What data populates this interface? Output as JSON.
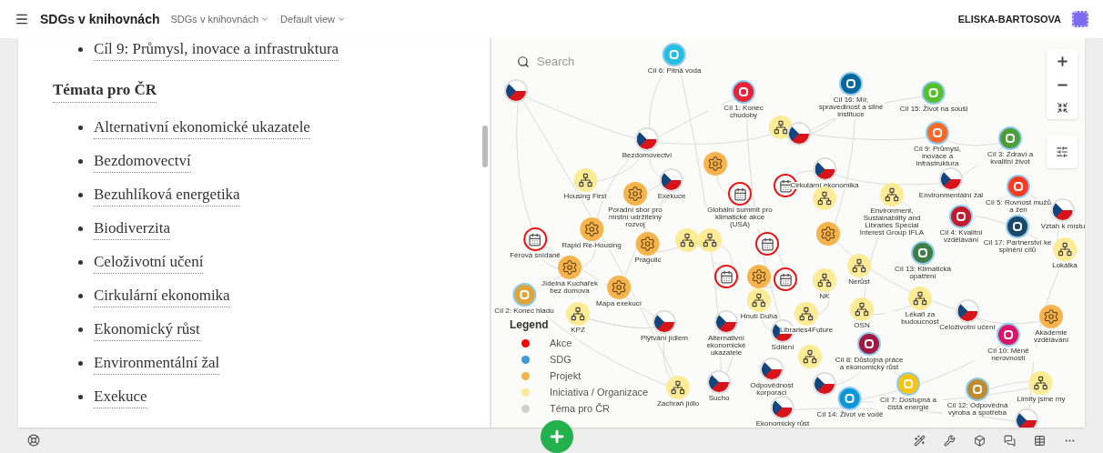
{
  "header": {
    "title": "SDGs v knihovnách",
    "menus": [
      "SDGs v knihovnách",
      "Default view"
    ],
    "user": "ELISKA-BARTOSOVA"
  },
  "document": {
    "links": [
      "Cíl 9: Průmysl, inovace a infrastruktura"
    ],
    "heading": "Témata pro ČR",
    "topics": [
      "Alternativní ekonomické ukazatele",
      "Bezdomovectví",
      "Bezuhlíková energetika",
      "Biodiverzita",
      "Celoživotní učení",
      "Cirkulární ekonomika",
      "Ekonomický růst",
      "Environmentální žal",
      "Exekuce"
    ]
  },
  "map": {
    "search": {
      "placeholder": "Search"
    },
    "legend": {
      "title": "Legend",
      "items": [
        {
          "label": "Akce",
          "color": "#ff0000"
        },
        {
          "label": "SDG",
          "color": "#3b9bd6"
        },
        {
          "label": "Projekt",
          "color": "#f7b44c"
        },
        {
          "label": "Iniciativa / Organizace",
          "color": "#fdeb96"
        },
        {
          "label": "Téma pro ČR",
          "color": "#cfcfcf"
        }
      ]
    },
    "nodes": [
      {
        "kind": "sdg",
        "label": "Cíl 6: Pitná voda",
        "color": "#26bde2"
      },
      {
        "kind": "topic"
      },
      {
        "kind": "sdg",
        "label": "Cíl 1: Konec chudoby",
        "color": "#e5243b"
      },
      {
        "kind": "topic",
        "label": "Bezdomovectví"
      },
      {
        "kind": "initiative"
      },
      {
        "kind": "topic"
      },
      {
        "kind": "project"
      },
      {
        "kind": "initiative",
        "label": "Housing First"
      },
      {
        "kind": "topic",
        "label": "Exekuce"
      },
      {
        "kind": "project",
        "label": "Poradní sbor pro místní udržitelný rozvoj"
      },
      {
        "kind": "event",
        "label": "Globální summit pro klimatické akce (USA)"
      },
      {
        "kind": "event"
      },
      {
        "kind": "project",
        "label": "Rapid Re-Housing"
      },
      {
        "kind": "project",
        "label": "Pragulic"
      },
      {
        "kind": "initiative"
      },
      {
        "kind": "initiative"
      },
      {
        "kind": "event",
        "label": "Férová snídaně"
      },
      {
        "kind": "event"
      },
      {
        "kind": "project",
        "label": "Jídelna Kuchařek bez domova"
      },
      {
        "kind": "project",
        "label": "Mapa exekucí"
      },
      {
        "kind": "sdg",
        "label": "Cíl 2: Konec hladu",
        "color": "#dda63a"
      },
      {
        "kind": "initiative",
        "label": "KPZ"
      },
      {
        "kind": "event"
      },
      {
        "kind": "project"
      },
      {
        "kind": "event"
      },
      {
        "kind": "initiative",
        "label": "Hnutí Duha"
      },
      {
        "kind": "topic",
        "label": "Plýtvání jídlem"
      },
      {
        "kind": "topic",
        "label": "Alternativní ekonomické ukazatele"
      },
      {
        "kind": "topic",
        "label": "Sdílení"
      },
      {
        "kind": "topic",
        "label": "Sucho"
      },
      {
        "kind": "topic",
        "label": "Odpovědnost korporací"
      },
      {
        "kind": "initiative",
        "label": "Zachraň jídlo"
      },
      {
        "kind": "topic",
        "label": "Ekonomický růst"
      },
      {
        "kind": "sdg",
        "label": "Cíl 16: Mír, spravedlnost a silné instituce",
        "color": "#00689d"
      },
      {
        "kind": "sdg",
        "label": "Cíl 15: Život na souši",
        "color": "#56c02b"
      },
      {
        "kind": "sdg",
        "label": "Cíl 9: Průmysl, inovace a infrastruktura",
        "color": "#fd6925"
      },
      {
        "kind": "sdg",
        "label": "Cíl 3: Zdraví a kvalitní život",
        "color": "#4c9f38"
      },
      {
        "kind": "topic",
        "label": "Cirkulární ekonomika"
      },
      {
        "kind": "topic",
        "label": "Environmentální žal"
      },
      {
        "kind": "sdg",
        "label": "Cíl 5: Rovnost mužů a žen",
        "color": "#ff3a21"
      },
      {
        "kind": "topic",
        "label": "Vztah k místu"
      },
      {
        "kind": "initiative",
        "label": "Environment, Sustainability and Libraries Special Interest Group IFLA"
      },
      {
        "kind": "sdg",
        "label": "Cíl 4: Kvalitní vzdělávání",
        "color": "#c5192d"
      },
      {
        "kind": "sdg",
        "label": "Cíl 17: Partnerství ke splnění cílů",
        "color": "#19486a"
      },
      {
        "kind": "initiative"
      },
      {
        "kind": "project"
      },
      {
        "kind": "sdg",
        "label": "Cíl 13: Klimatická opatření",
        "color": "#3f7e44"
      },
      {
        "kind": "initiative",
        "label": "Lokálka"
      },
      {
        "kind": "initiative",
        "label": "Nerůst"
      },
      {
        "kind": "initiative",
        "label": "NK"
      },
      {
        "kind": "initiative",
        "label": "Libraries4Future"
      },
      {
        "kind": "initiative",
        "label": "OSN"
      },
      {
        "kind": "initiative",
        "label": "Lékaři za budoucnost"
      },
      {
        "kind": "topic",
        "label": "Celoživotní učení"
      },
      {
        "kind": "project",
        "label": "Akademie vzdělávání"
      },
      {
        "kind": "sdg",
        "label": "Cíl 10: Méně nerovností",
        "color": "#dd1367"
      },
      {
        "kind": "initiative"
      },
      {
        "kind": "topic"
      },
      {
        "kind": "sdg",
        "label": "Cíl 8: Důstojná práce a ekonomický růst",
        "color": "#a21942"
      },
      {
        "kind": "sdg",
        "label": "Cíl 7: Dostupná a čistá energie",
        "color": "#fcc30b"
      },
      {
        "kind": "sdg",
        "label": "Cíl 12: Odpovědná výroba a spotřeba",
        "color": "#bf8b2e"
      },
      {
        "kind": "initiative",
        "label": "Limity jsme my"
      },
      {
        "kind": "sdg",
        "label": "Cíl 14: Život ve vodě",
        "color": "#0a97d9"
      },
      {
        "kind": "topic"
      }
    ]
  }
}
